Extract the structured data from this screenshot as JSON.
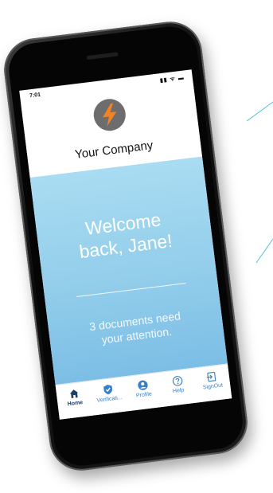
{
  "status_bar": {
    "time": "7:01",
    "indicators": "▮▮ ᯤ ▬"
  },
  "header": {
    "company_name": "Your Company",
    "logo_icon": "lightning-bolt-icon"
  },
  "hero": {
    "welcome_line1": "Welcome",
    "welcome_line2": "back, Jane!",
    "docs_line1": "3 documents need",
    "docs_line2": "your attention."
  },
  "tabbar": {
    "items": [
      {
        "label": "Home",
        "icon": "home-icon",
        "active": true
      },
      {
        "label": "Verificati...",
        "icon": "shield-check-icon"
      },
      {
        "label": "Profile",
        "icon": "user-icon"
      },
      {
        "label": "Help",
        "icon": "help-icon"
      },
      {
        "label": "SignOut",
        "icon": "sign-out-icon"
      }
    ]
  },
  "colors": {
    "accent": "#3b7fc4",
    "active_tab": "#1c3f6e",
    "hero_top": "#a9dcf2",
    "hero_bottom": "#7cbee6",
    "logo_bolt": "#f58220",
    "logo_circle": "#6d6d6f"
  }
}
